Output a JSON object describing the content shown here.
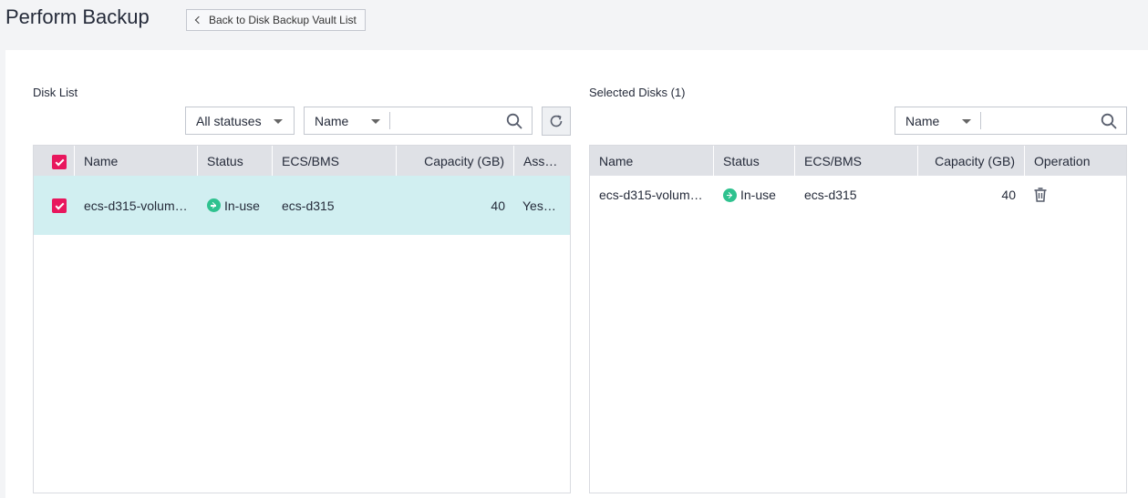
{
  "page": {
    "title": "Perform Backup",
    "back_label": "Back to Disk Backup Vault List"
  },
  "disk_list": {
    "label": "Disk List",
    "status_filter": "All statuses",
    "search_field": "Name",
    "search_value": "",
    "columns": [
      "Name",
      "Status",
      "ECS/BMS",
      "Capacity (GB)",
      "Ass…"
    ],
    "rows": [
      {
        "name": "ecs-d315-volum…",
        "status": "In-use",
        "ecs": "ecs-d315",
        "capacity": "40",
        "assoc": "Yes…",
        "selected": true
      }
    ]
  },
  "selected_disks": {
    "label": "Selected Disks (1)",
    "search_field": "Name",
    "search_value": "",
    "columns": [
      "Name",
      "Status",
      "ECS/BMS",
      "Capacity (GB)",
      "Operation"
    ],
    "rows": [
      {
        "name": "ecs-d315-volum…",
        "status": "In-use",
        "ecs": "ecs-d315",
        "capacity": "40"
      }
    ]
  },
  "colors": {
    "accent_checkbox": "#e8175d",
    "status_ok": "#2fc28f",
    "selected_row": "#d1eff1",
    "header_bg": "#dfe1e6"
  }
}
